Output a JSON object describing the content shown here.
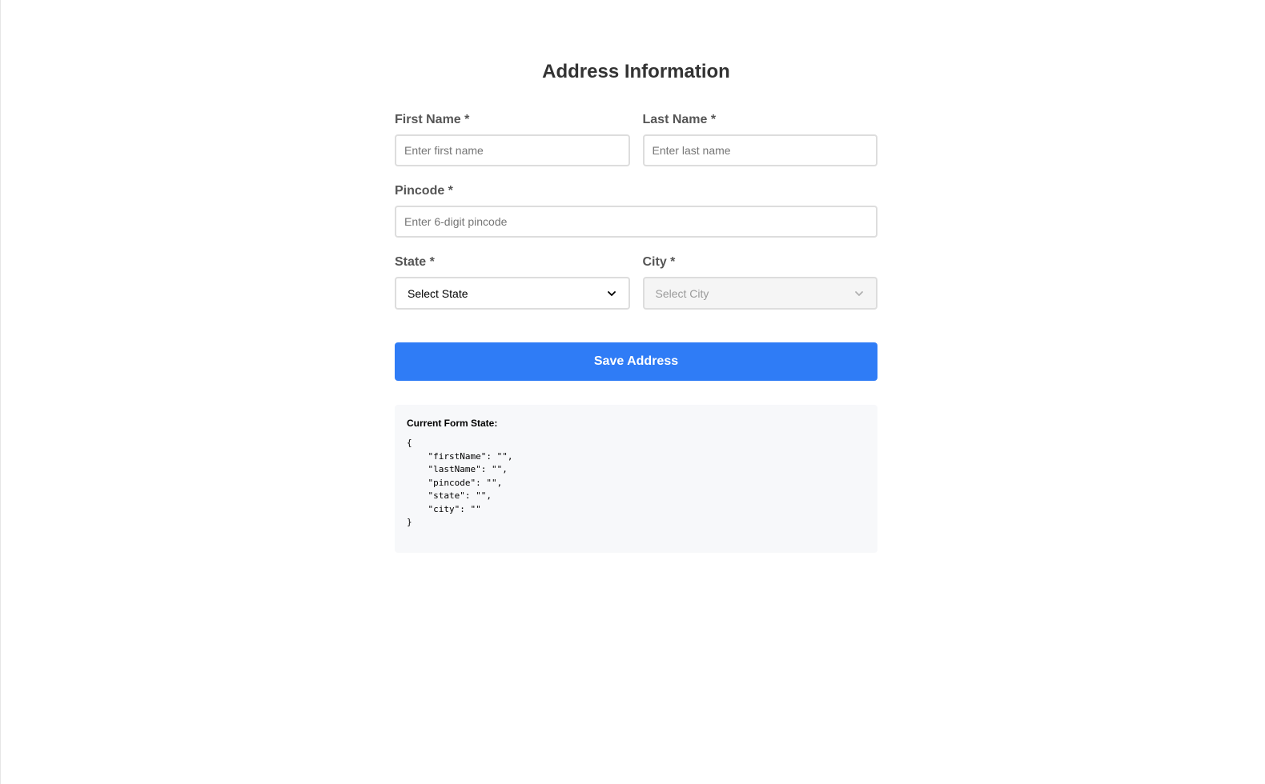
{
  "form": {
    "title": "Address Information",
    "first_name": {
      "label": "First Name *",
      "placeholder": "Enter first name",
      "value": ""
    },
    "last_name": {
      "label": "Last Name *",
      "placeholder": "Enter last name",
      "value": ""
    },
    "pincode": {
      "label": "Pincode *",
      "placeholder": "Enter 6-digit pincode",
      "value": ""
    },
    "state": {
      "label": "State *",
      "selected": "Select State"
    },
    "city": {
      "label": "City *",
      "selected": "Select City",
      "disabled": true
    },
    "save_label": "Save Address"
  },
  "debug": {
    "title": "Current Form State:",
    "json_text": "{\n    \"firstName\": \"\",\n    \"lastName\": \"\",\n    \"pincode\": \"\",\n    \"state\": \"\",\n    \"city\": \"\"\n}"
  },
  "colors": {
    "accent": "#2f7cf6",
    "title": "#333333",
    "label": "#555555",
    "panel_bg": "#f7f8fa"
  },
  "icons": {
    "select_arrow": "chevron-down-icon"
  }
}
